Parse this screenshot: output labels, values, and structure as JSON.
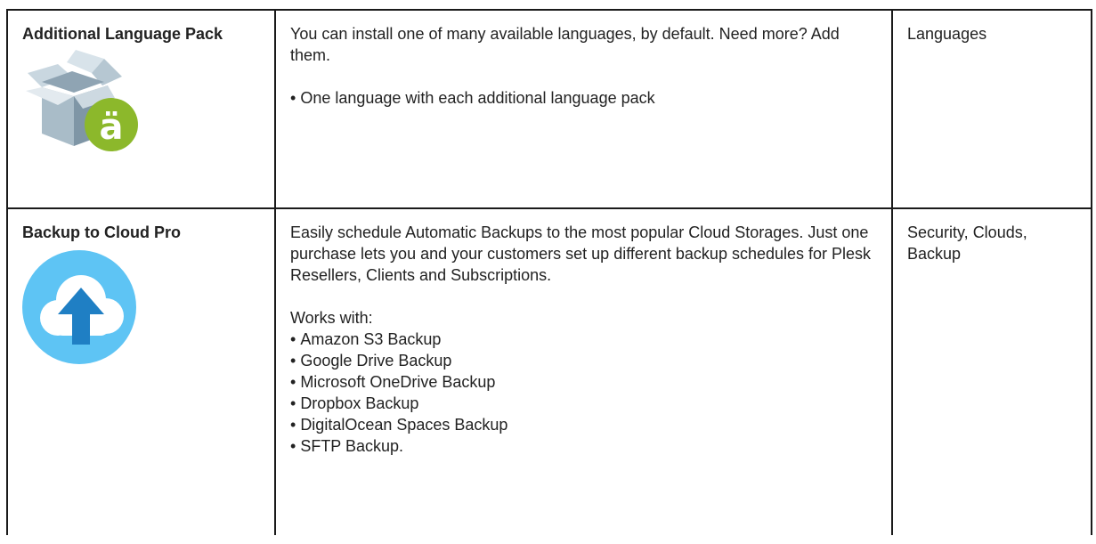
{
  "rows": [
    {
      "name": "Additional Language Pack",
      "icon": "language-pack-box-icon",
      "description": "You can install one of many available languages, by default. Need more? Add them.",
      "bullets": [
        "One language with each additional language pack"
      ],
      "categories": "Languages",
      "icon_badge_text": "ä",
      "badge_color": "#8cb82b"
    },
    {
      "name": "Backup to Cloud Pro",
      "icon": "cloud-upload-icon",
      "description": "Easily schedule Automatic Backups to the most popular Cloud Storages. Just one purchase lets you and your customers set up different backup schedules for Plesk Resellers, Clients and Subscriptions.",
      "works_with_label": "Works with:",
      "bullets": [
        "Amazon S3 Backup",
        "Google Drive Backup",
        "Microsoft OneDrive Backup",
        "Dropbox Backup",
        "DigitalOcean Spaces Backup",
        "SFTP Backup."
      ],
      "categories": "Security, Clouds, Backup",
      "circle_color": "#5ec4f4",
      "arrow_color": "#1f7fc4"
    }
  ]
}
